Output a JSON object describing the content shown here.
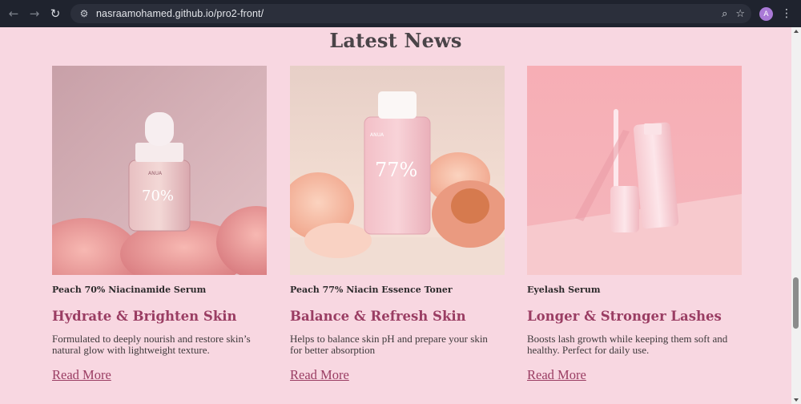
{
  "browser": {
    "url": "nasraamohamed.github.io/pro2-front/",
    "back_icon": "arrow-left-icon",
    "forward_icon": "arrow-right-icon",
    "reload_icon": "reload-icon",
    "profile_initial": "A"
  },
  "section": {
    "title": "Latest News"
  },
  "cards": [
    {
      "product": "Peach 70% Niacinamide Serum",
      "headline": "Hydrate & Brighten Skin",
      "description": "Formulated to deeply nourish and restore skin’s natural glow with lightweight texture.",
      "link": "Read More",
      "bottle_text": "70%",
      "bottle_brand": "ANUA"
    },
    {
      "product": "Peach 77% Niacin Essence Toner",
      "headline": "Balance & Refresh Skin",
      "description": "Helps to balance skin pH and prepare your skin for better absorption",
      "link": "Read More",
      "bottle_text": "77%",
      "bottle_brand": "ANUA"
    },
    {
      "product": "Eyelash Serum",
      "headline": "Longer & Stronger Lashes",
      "description": "Boosts lash growth while keeping them soft and healthy. Perfect for daily use.",
      "link": "Read More"
    }
  ],
  "colors": {
    "page_bg": "#f8d7e1",
    "accent": "#9a3d63",
    "chrome_bg": "#1f232e"
  }
}
